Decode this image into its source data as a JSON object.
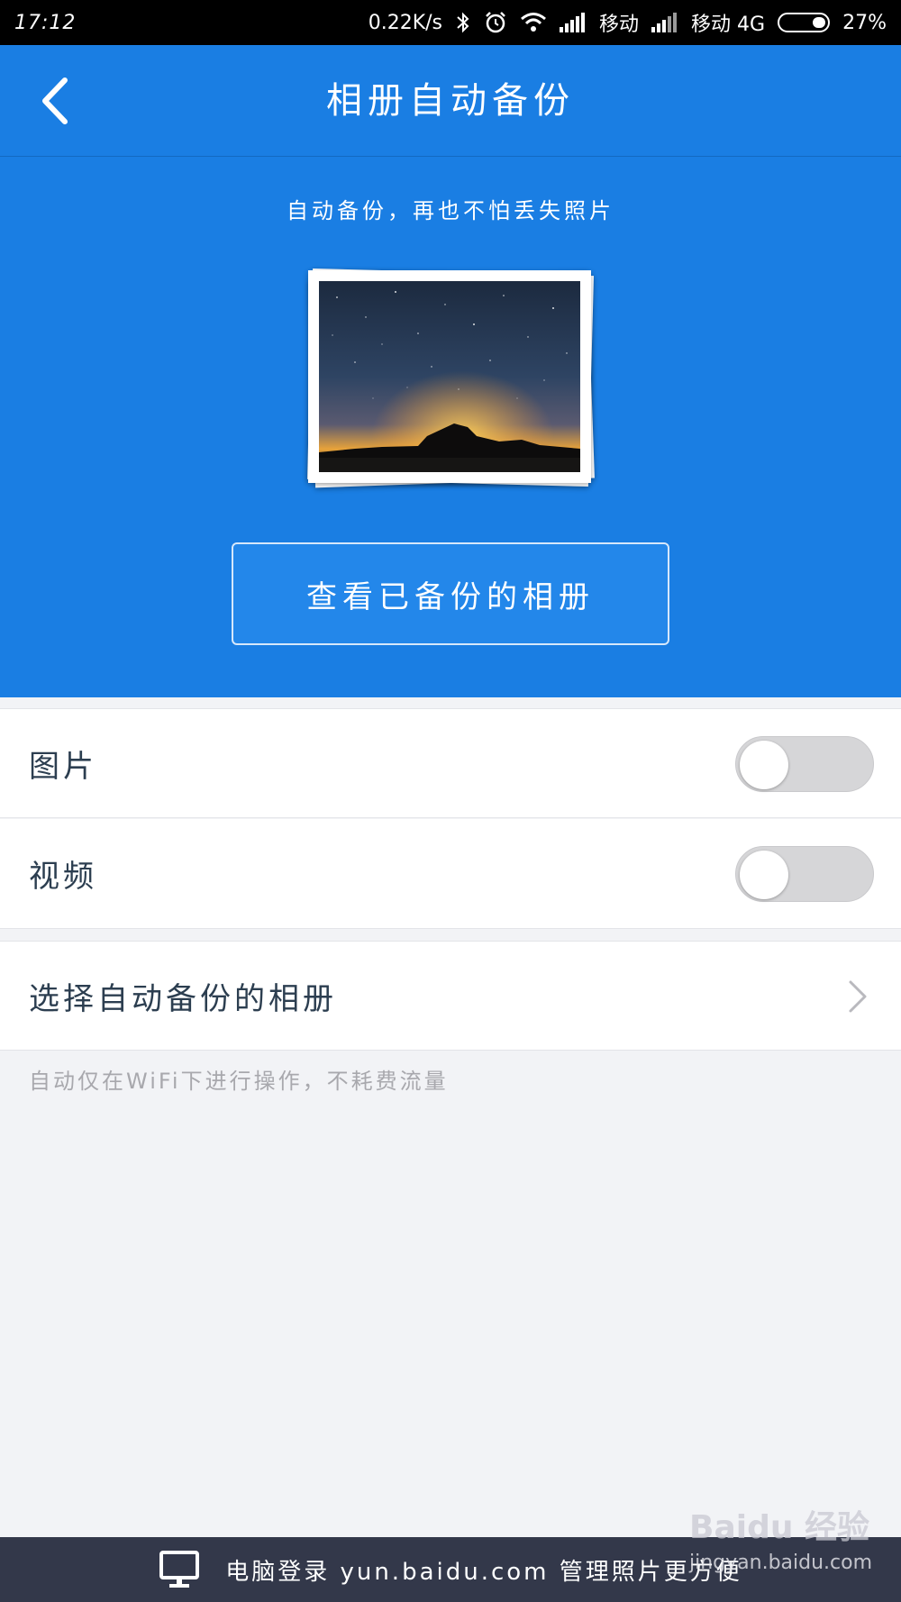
{
  "status_bar": {
    "time": "17:12",
    "net_speed": "0.22K/s",
    "carrier1": "移动",
    "carrier2": "移动 4G",
    "battery": "27%",
    "icons": [
      "bluetooth-icon",
      "alarm-icon",
      "wifi-icon",
      "signal-icon",
      "signal-icon",
      "battery-icon"
    ]
  },
  "header": {
    "title": "相册自动备份",
    "back_icon": "back-chevron-icon"
  },
  "hero": {
    "subtitle": "自动备份，再也不怕丢失照片",
    "view_button": "查看已备份的相册"
  },
  "settings": {
    "photos": {
      "label": "图片",
      "enabled": false
    },
    "videos": {
      "label": "视频",
      "enabled": false
    },
    "select_album": {
      "label": "选择自动备份的相册"
    },
    "note": "自动仅在WiFi下进行操作，不耗费流量"
  },
  "bottom_bar": {
    "text": "电脑登录 yun.baidu.com 管理照片更方便",
    "icon": "monitor-icon"
  },
  "watermark": {
    "brand": "Baidu 经验",
    "url": "jingyan.baidu.com"
  },
  "colors": {
    "primary": "#1a7ee3",
    "bottom_bar": "#33384a",
    "page_bg": "#f2f3f6"
  }
}
